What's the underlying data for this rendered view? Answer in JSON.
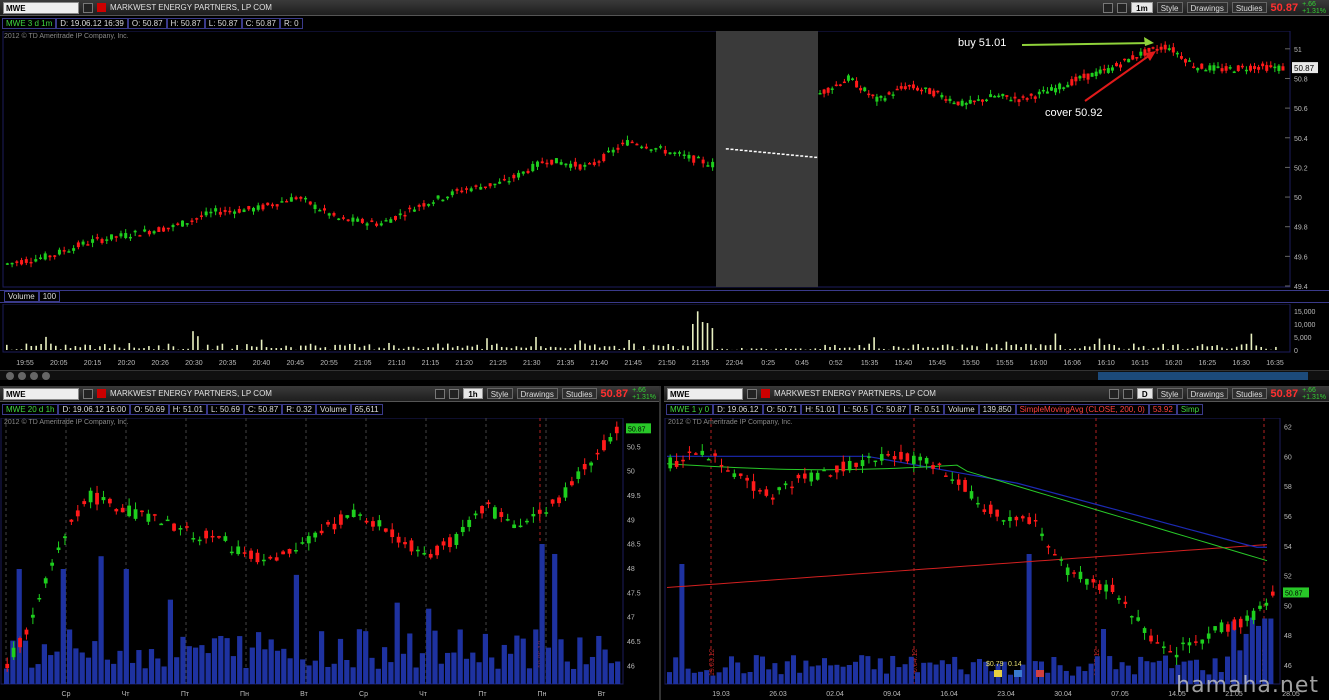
{
  "top": {
    "symbol": "MWE",
    "company": "MARKWEST ENERGY PARTNERS, LP COM",
    "aggregation": "1m",
    "style_label": "Style",
    "drawings_label": "Drawings",
    "studies_label": "Studies",
    "last_price": "50.87",
    "change": "+.66",
    "change_pct": "+1.31%",
    "info_title": "MWE 3 d 1m",
    "info_d": "D: 19.06.12 16:39",
    "info_o": "O: 50.87",
    "info_h": "H: 50.87",
    "info_l": "L: 50.87",
    "info_c": "C: 50.87",
    "info_r": "R: 0",
    "copyright": "2012 © TD Ameritrade IP Company, Inc.",
    "volume_label": "Volume",
    "volume_value": "100",
    "last_box": "50.87",
    "buy_label": "buy 51.01",
    "cover_label": "cover 50.92",
    "price_ticks": [
      "51",
      "50.8",
      "50.6",
      "50.4",
      "50.2",
      "50",
      "49.8",
      "49.6",
      "49.4"
    ],
    "volume_ticks": [
      "15,000",
      "10,000",
      "5,000",
      "0"
    ],
    "time_ticks": [
      "19:55",
      "20:05",
      "20:15",
      "20:20",
      "20:26",
      "20:30",
      "20:35",
      "20:40",
      "20:45",
      "20:55",
      "21:05",
      "21:10",
      "21:15",
      "21:20",
      "21:25",
      "21:30",
      "21:35",
      "21:40",
      "21:45",
      "21:50",
      "21:55",
      "22:04",
      "0:25",
      "0:45",
      "0:52",
      "15:35",
      "15:40",
      "15:45",
      "15:50",
      "15:55",
      "16:00",
      "16:06",
      "16:10",
      "16:15",
      "16:20",
      "16:25",
      "16:30",
      "16:35"
    ]
  },
  "left": {
    "symbol": "MWE",
    "company": "MARKWEST ENERGY PARTNERS, LP COM",
    "aggregation": "1h",
    "style_label": "Style",
    "drawings_label": "Drawings",
    "studies_label": "Studies",
    "last_price": "50.87",
    "change": "+.66",
    "change_pct": "+1.31%",
    "info_title": "MWE 20 d 1h",
    "info_d": "D: 19.06.12 16:00",
    "info_o": "O: 50.69",
    "info_h": "H: 51.01",
    "info_l": "L: 50.69",
    "info_c": "C: 50.87",
    "info_r": "R: 0.32",
    "info_v": "Volume",
    "info_vv": "65,611",
    "copyright": "2012 © TD Ameritrade IP Company, Inc.",
    "last_box": "50.87",
    "price_ticks": [
      "50.5",
      "50",
      "49.5",
      "49",
      "48.5",
      "48",
      "47.5",
      "47",
      "46.5",
      "46"
    ],
    "day_ticks": [
      "Ср",
      "Чт",
      "Пт",
      "Пн",
      "Вт",
      "Ср",
      "Чт",
      "Пт",
      "Пн",
      "Вт"
    ],
    "date_marker": "18.06.12"
  },
  "right": {
    "symbol": "MWE",
    "company": "MARKWEST ENERGY PARTNERS, LP COM",
    "aggregation": "D",
    "style_label": "Style",
    "drawings_label": "Drawings",
    "studies_label": "Studies",
    "last_price": "50.87",
    "change": "+.66",
    "change_pct": "+1.31%",
    "info_title": "MWE 1 y 0",
    "info_d": "D: 19.06.12",
    "info_o": "O: 50.71",
    "info_h": "H: 51.01",
    "info_l": "L: 50.5",
    "info_c": "C: 50.87",
    "info_r": "R: 0.51",
    "info_v": "Volume",
    "info_vv": "139,850",
    "sma1": "SimpleMovingAvg (CLOSE, 200, 0)",
    "sma1_val": "53.92",
    "sma2_short": "Simp",
    "copyright": "2012 © TD Ameritrade IP Company, Inc.",
    "last_box": "50.87",
    "price_ticks": [
      "62",
      "60",
      "58",
      "56",
      "54",
      "52",
      "50",
      "48",
      "46"
    ],
    "date_ticks": [
      "19.03",
      "26.03",
      "02.04",
      "09.04",
      "16.04",
      "23.04",
      "30.04",
      "07.05",
      "14.05",
      "21.05",
      "28.05"
    ],
    "date_markers": [
      "19.03.12",
      "20.04.12",
      "18.05.12",
      "18.06.12"
    ],
    "earn_label": "$0.79",
    "earn_label2": "0.14"
  },
  "watermark": "hamaha.net",
  "colors": {
    "up": "#1ecf1e",
    "down": "#ff1a1a",
    "flat": "#ffffff",
    "volume_bar": "#1e32a0",
    "grid": "#2a2a5a",
    "sma200": "#d22020",
    "sma_green": "#28c828",
    "sma_blue": "#1c2ab4"
  }
}
